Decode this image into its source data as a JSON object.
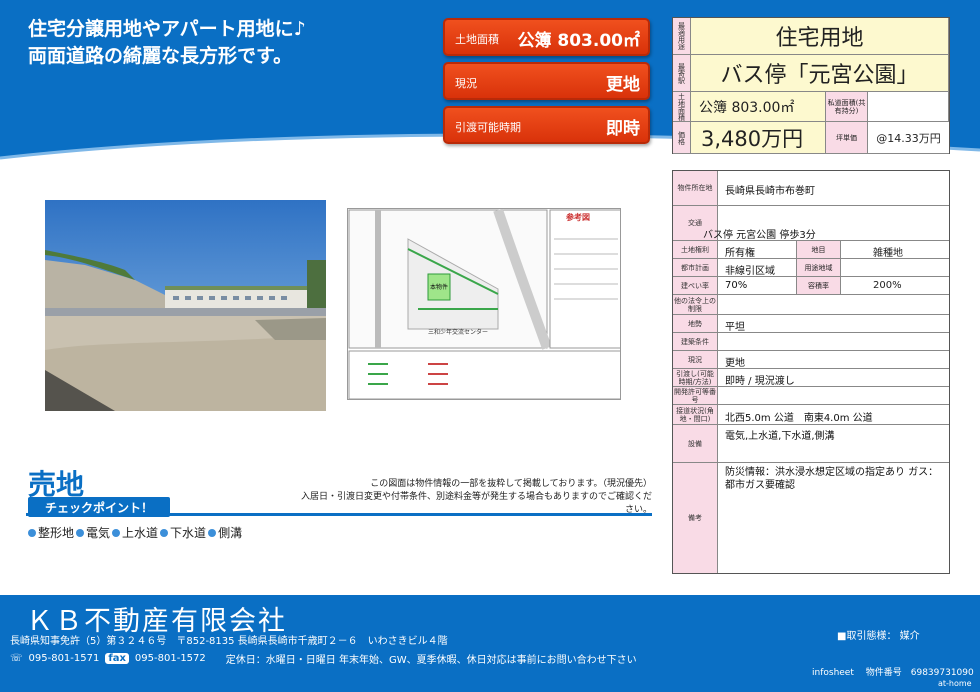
{
  "catch_copy": [
    "住宅分譲用地やアパート用地に♪",
    "両面道路の綺麗な長方形です。"
  ],
  "buttons": [
    {
      "label": "土地面積",
      "value": "公簿 803.00㎡"
    },
    {
      "label": "現況",
      "value": "更地"
    },
    {
      "label": "引渡可能時期",
      "value": "即時"
    }
  ],
  "summary": {
    "type_label": "最適用途",
    "type_value": "住宅用地",
    "station_label": "最寄駅",
    "station_value": "バス停「元宮公園」",
    "area_label": "土地面積",
    "area_value": "公簿 803.00㎡",
    "private_road_label": "私道面積(共有持分)",
    "price_label": "価格",
    "price_value": "3,480万円",
    "tsubo_label": "坪単価",
    "tsubo_value": "@14.33万円"
  },
  "details": {
    "location_label": "物件所在地",
    "location_value": "長崎県長崎市布巻町",
    "transport_label": "交通",
    "transport_value": "バス停 元宮公園 停歩3分",
    "land_right_label": "土地権利",
    "land_right_value": "所有権",
    "land_category_label": "地目",
    "land_category_value": "雑種地",
    "city_plan_label": "都市計画",
    "city_plan_value": "非線引区域",
    "zoning_label": "用途地域",
    "zoning_value": "",
    "coverage_label": "建ぺい率",
    "coverage_value": "70%",
    "far_label": "容積率",
    "far_value": "200%",
    "other_label": "他の法令上の制限",
    "terrain_label": "地勢",
    "terrain_value": "平坦",
    "build_cond_label": "建築条件",
    "status_label": "現況",
    "status_value": "更地",
    "handover_label": "引渡し(可能時期/方法)",
    "handover_value": "即時 / 現況渡し",
    "dev_label": "開発許可等番号",
    "road_label": "接道状況(角地・間口)",
    "road_value": "北西5.0m 公道　南東4.0m 公道",
    "facility_label": "設備",
    "facility_value": "電気,上水道,下水道,側溝",
    "remarks_label": "備考",
    "remarks_value": "防災情報：洪水浸水想定区域の指定あり ガス：都市ガス要確認"
  },
  "map": {
    "title": "参考図",
    "center_label": "三和少年交流センター",
    "site_label": "本物件"
  },
  "notes": [
    "この図面は物件情報の一部を抜粋して掲載しております。（現況優先）",
    "入居日・引渡日変更や付帯条件、別途料金等が発生する場合もありますのでご確認ください。"
  ],
  "sale_title": "売地",
  "check_label": "チェックポイント！",
  "points": [
    "整形地",
    "電気",
    "上水道",
    "下水道",
    "側溝"
  ],
  "footer": {
    "company": "ＫＢ不動産有限会社",
    "license": "長崎県知事免許（5）第３２４６号　〒852-8135 長崎県長崎市千歳町２－６　いわさきビル４階",
    "tel": "095-801-1571",
    "fax_label": "fax",
    "fax": "095-801-1572",
    "holiday": "定休日：水曜日・日曜日 年末年始、GW、夏季休暇、休日対応は事前にお問い合わせ下さい",
    "transaction": "■取引態様：  媒介",
    "info": "infosheet　 物件番号　69839731090",
    "athome": "at-home"
  },
  "colors": {
    "brand_blue": "#0a6fc4",
    "button_red": "#e0401a",
    "label_pink": "#f9dbe6",
    "value_cream": "#fdf9cf"
  }
}
